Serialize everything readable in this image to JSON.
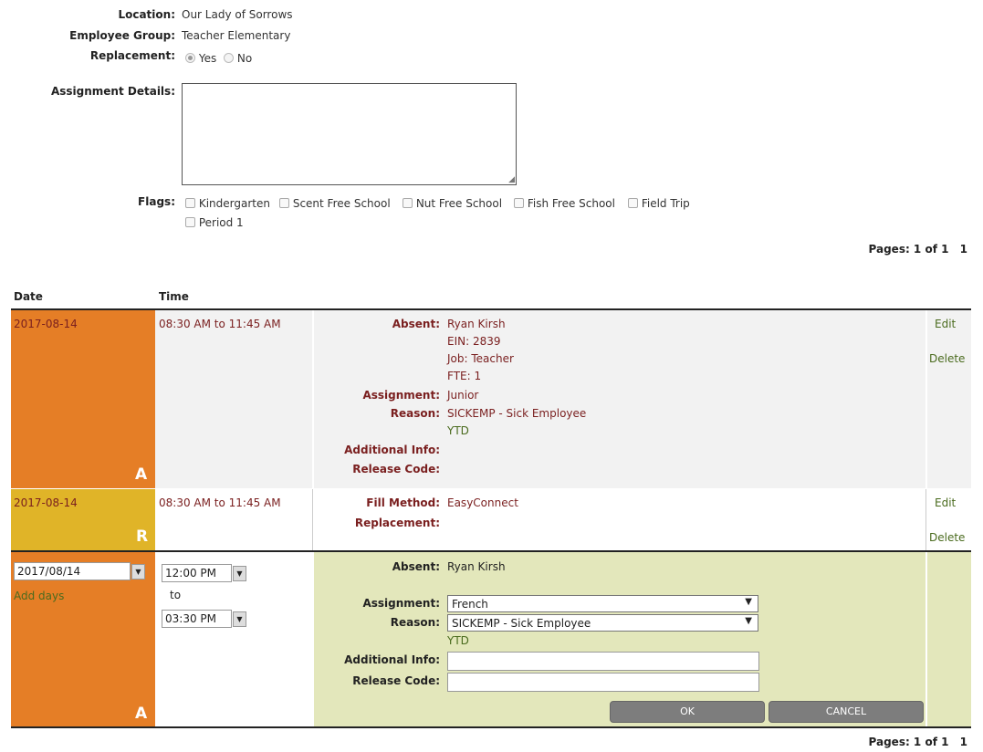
{
  "header": {
    "location_label": "Location:",
    "location_value": "Our Lady of Sorrows",
    "group_label": "Employee Group:",
    "group_value": "Teacher Elementary",
    "replacement_label": "Replacement:",
    "replacement_yes": "Yes",
    "replacement_no": "No",
    "details_label": "Assignment Details:",
    "flags_label": "Flags:",
    "flags": [
      "Kindergarten",
      "Scent Free School",
      "Nut Free School",
      "Fish Free School",
      "Field Trip",
      "Period 1"
    ]
  },
  "pager_top": {
    "text": "Pages: 1 of 1",
    "page": "1"
  },
  "table": {
    "col_date": "Date",
    "col_time": "Time",
    "row1": {
      "date": "2017-08-14",
      "time": "08:30 AM to 11:45 AM",
      "letter": "A",
      "absent_label": "Absent:",
      "absent_name": "Ryan Kirsh",
      "ein": "EIN: 2839",
      "job": "Job: Teacher",
      "fte": "FTE: 1",
      "assignment_label": "Assignment:",
      "assignment": "Junior",
      "reason_label": "Reason:",
      "reason": "SICKEMP - Sick Employee",
      "ytd": "YTD",
      "additional_label": "Additional Info:",
      "release_label": "Release Code:",
      "edit": "Edit",
      "delete": "Delete"
    },
    "row2": {
      "date": "2017-08-14",
      "time": "08:30 AM to 11:45 AM",
      "letter": "R",
      "fill_label": "Fill Method:",
      "fill_value": "EasyConnect",
      "replacement_label": "Replacement:",
      "edit": "Edit",
      "delete": "Delete"
    },
    "row3": {
      "date_value": "2017/08/14",
      "add_days": "Add days",
      "start_time": "12:00 PM",
      "to": "to",
      "end_time": "03:30 PM",
      "letter": "A",
      "absent_label": "Absent:",
      "absent_name": "Ryan Kirsh",
      "assignment_label": "Assignment:",
      "assignment_value": "French",
      "reason_label": "Reason:",
      "reason_value": "SICKEMP - Sick Employee",
      "ytd": "YTD",
      "additional_label": "Additional Info:",
      "release_label": "Release Code:",
      "ok": "OK",
      "cancel": "CANCEL"
    }
  },
  "pager_bottom": {
    "text": "Pages: 1 of 1",
    "page": "1"
  },
  "colors": {
    "orange": "#e57e26",
    "yellow": "#e0b428",
    "gray_row": "#f2f2f2",
    "edit_row": "#e3e7bb",
    "dark_red": "#7a1f1f",
    "green": "#4a6b1e"
  }
}
